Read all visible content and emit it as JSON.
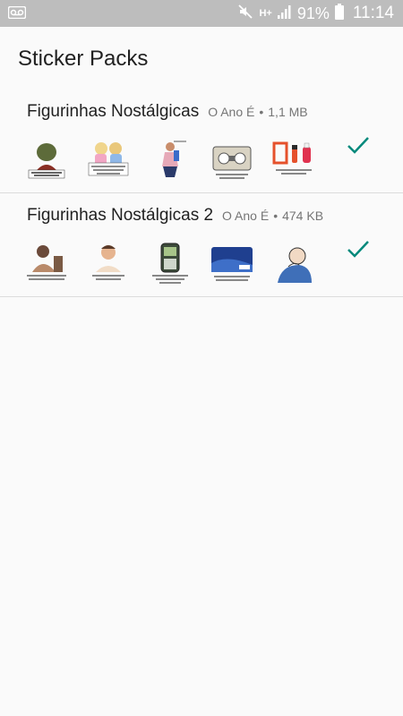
{
  "status_bar": {
    "battery_percent": "91%",
    "time": "11:14",
    "network_label": "H+",
    "icons": [
      "voicemail-icon",
      "mute-icon",
      "signal-icon",
      "battery-icon"
    ]
  },
  "app_bar": {
    "title": "Sticker Packs"
  },
  "packs": [
    {
      "name": "Figurinhas Nostálgicas",
      "publisher": "O Ano É",
      "size": "1,1 MB",
      "added": true,
      "stickers": [
        "sticker-1",
        "sticker-2",
        "sticker-3",
        "sticker-4",
        "sticker-5"
      ]
    },
    {
      "name": "Figurinhas Nostálgicas 2",
      "publisher": "O Ano É",
      "size": "474 KB",
      "added": true,
      "stickers": [
        "sticker-1",
        "sticker-2",
        "sticker-3",
        "sticker-4",
        "sticker-5"
      ]
    }
  ],
  "separator": "•",
  "colors": {
    "status_bar_bg": "#bdbdbd",
    "background": "#fafafa",
    "check": "#00897b",
    "divider": "#dcdcdc"
  }
}
